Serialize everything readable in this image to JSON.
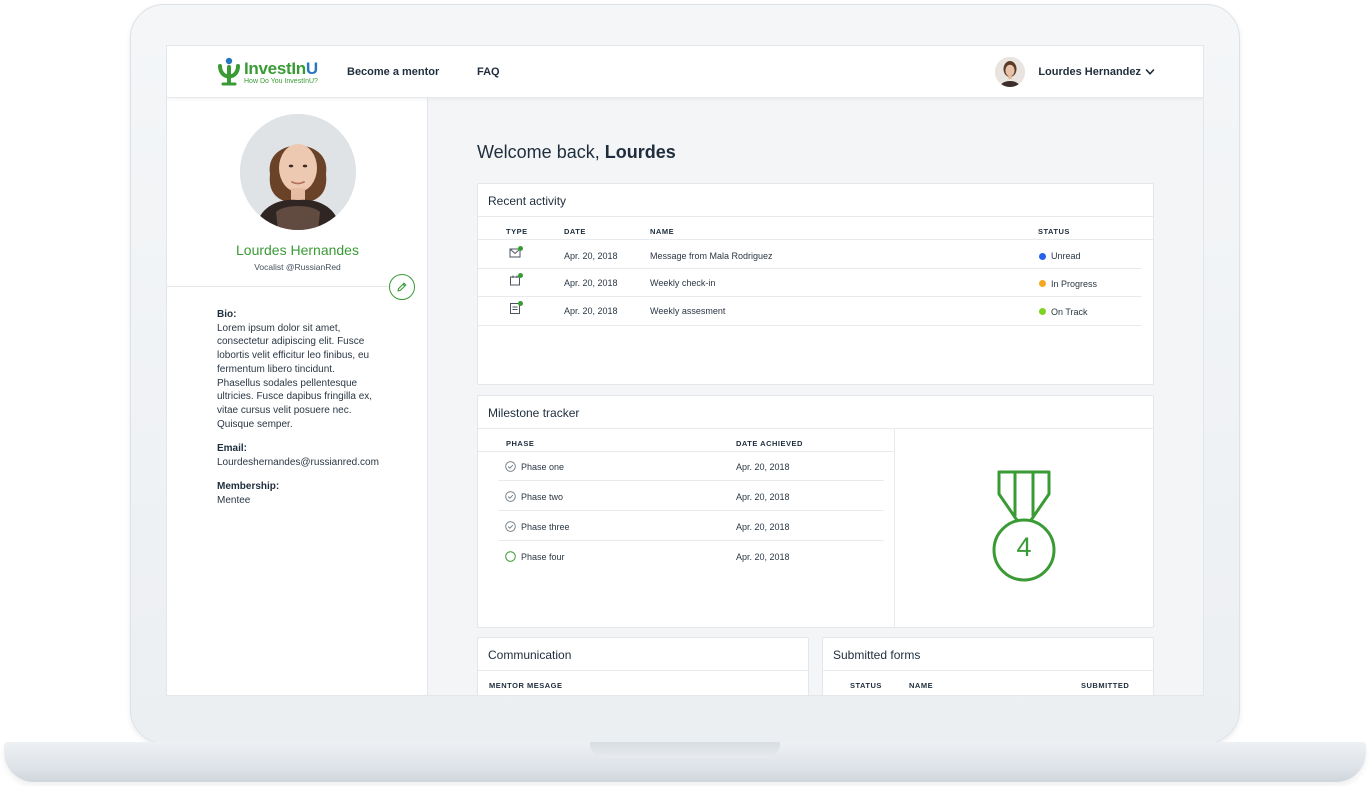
{
  "brand": {
    "name_a": "InvestIn",
    "name_b": "U",
    "tagline": "How Do You InvestInU?",
    "green": "#3a9b35",
    "blue": "#2877c2"
  },
  "nav": {
    "links": [
      "Become a mentor",
      "FAQ"
    ],
    "user_name": "Lourdes Hernandez"
  },
  "profile": {
    "name": "Lourdes Hernandes",
    "subtitle": "Vocalist @RussianRed",
    "bio_label": "Bio:",
    "bio_lines": [
      "Lorem ipsum dolor sit amet,",
      "consectetur adipiscing elit. Fusce",
      "lobortis velit efficitur leo finibus, eu",
      "fermentum libero tincidunt.",
      "Phasellus sodales pellentesque",
      "ultricies. Fusce dapibus fringilla ex,",
      "vitae cursus velit posuere nec.",
      "Quisque semper."
    ],
    "email_label": "Email:",
    "email": "Lourdeshernandes@russianred.com",
    "membership_label": "Membership:",
    "membership": "Mentee"
  },
  "welcome": {
    "prefix": "Welcome back,",
    "name": "Lourdes"
  },
  "recent_activity": {
    "title": "Recent activity",
    "columns": [
      "TYPE",
      "DATE",
      "NAME",
      "STATUS"
    ],
    "rows": [
      {
        "icon": "mail-icon",
        "date": "Apr. 20, 2018",
        "name": "Message from Mala Rodriguez",
        "status": "Unread",
        "status_color": "#2563eb"
      },
      {
        "icon": "calendar-icon",
        "date": "Apr. 20, 2018",
        "name": "Weekly check-in",
        "status": "In Progress",
        "status_color": "#f5a623"
      },
      {
        "icon": "document-icon",
        "date": "Apr. 20, 2018",
        "name": "Weekly assesment",
        "status": "On Track",
        "status_color": "#7ed321"
      }
    ]
  },
  "milestone": {
    "title": "Milestone tracker",
    "columns": [
      "PHASE",
      "DATE ACHIEVED"
    ],
    "rows": [
      {
        "phase": "Phase one",
        "date": "Apr. 20, 2018",
        "done": true
      },
      {
        "phase": "Phase two",
        "date": "Apr. 20, 2018",
        "done": true
      },
      {
        "phase": "Phase three",
        "date": "Apr. 20, 2018",
        "done": true
      },
      {
        "phase": "Phase four",
        "date": "Apr. 20, 2018",
        "done": false
      }
    ],
    "badge_number": "4"
  },
  "communication": {
    "title": "Communication",
    "columns": [
      "MENTOR MESAGE"
    ]
  },
  "submitted_forms": {
    "title": "Submitted forms",
    "columns": [
      "STATUS",
      "NAME",
      "SUBMITTED"
    ]
  }
}
